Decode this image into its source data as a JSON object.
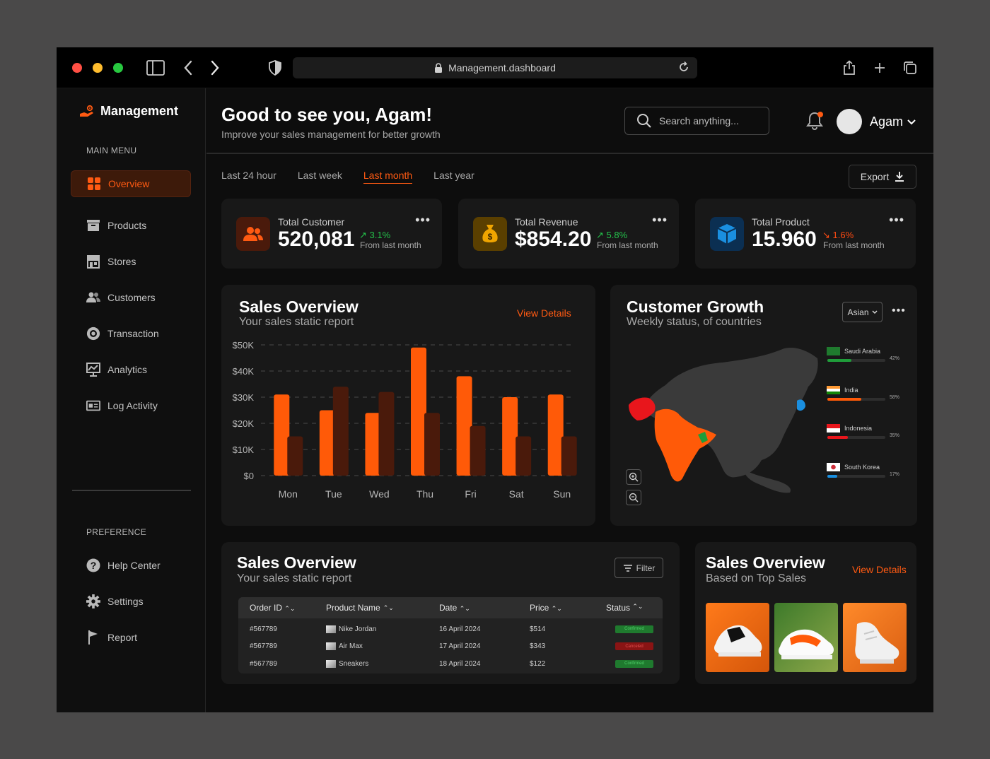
{
  "browser": {
    "url": "Management.dashboard"
  },
  "sidebar": {
    "brand": "Management",
    "main_menu_label": "MAIN MENU",
    "items": [
      {
        "label": "Overview",
        "icon": "grid-icon"
      },
      {
        "label": "Products",
        "icon": "box-icon"
      },
      {
        "label": "Stores",
        "icon": "store-icon"
      },
      {
        "label": "Customers",
        "icon": "users-icon"
      },
      {
        "label": "Transaction",
        "icon": "coin-icon"
      },
      {
        "label": "Analytics",
        "icon": "analytics-icon"
      },
      {
        "label": "Log Activity",
        "icon": "log-icon"
      }
    ],
    "preference_label": "PREFERENCE",
    "pref_items": [
      {
        "label": "Help Center",
        "icon": "help-icon"
      },
      {
        "label": "Settings",
        "icon": "gear-icon"
      },
      {
        "label": "Report",
        "icon": "flag-icon"
      }
    ]
  },
  "header": {
    "greeting": "Good to see you,  Agam!",
    "subtitle": "Improve your sales management  for better growth",
    "search_placeholder": "Search anything...",
    "user_name": "Agam"
  },
  "tabs": [
    "Last 24 hour",
    "Last week",
    "Last month",
    "Last year"
  ],
  "export_label": "Export",
  "stats": [
    {
      "label": "Total Customer",
      "value": "520,081",
      "change": "3.1%",
      "direction": "up",
      "from": "From last month"
    },
    {
      "label": "Total Revenue",
      "value": "$854.20",
      "change": "5.8%",
      "direction": "up",
      "from": "From last month"
    },
    {
      "label": "Total Product",
      "value": "15.960",
      "change": "1.6%",
      "direction": "down",
      "from": "From last month"
    }
  ],
  "sales_chart": {
    "title": "Sales Overview",
    "subtitle": "Your sales static report",
    "link": "View Details"
  },
  "chart_data": {
    "type": "bar",
    "categories": [
      "Mon",
      "Tue",
      "Wed",
      "Thu",
      "Fri",
      "Sat",
      "Sun"
    ],
    "series": [
      {
        "values": [
          31,
          25,
          24,
          49,
          38,
          30,
          31
        ],
        "color": "#ff5a08"
      },
      {
        "values": [
          15,
          34,
          32,
          24,
          19,
          15,
          15
        ],
        "color": "#4a1a0b"
      }
    ],
    "yticks": [
      "$0",
      "$10K",
      "$20K",
      "$30K",
      "$40K",
      "$50K"
    ],
    "ylim": [
      0,
      50
    ],
    "grid": true
  },
  "growth": {
    "title": "Customer Growth",
    "subtitle": "Weekly status, of countries",
    "region": "Asian",
    "countries": [
      {
        "name": "Saudi Arabia",
        "pct": "42%",
        "value": 42,
        "color": "#1f9d3a",
        "flag": "saudi-flag"
      },
      {
        "name": "India",
        "pct": "58%",
        "value": 58,
        "color": "#ff5a08",
        "flag": "india-flag"
      },
      {
        "name": "Indonesia",
        "pct": "35%",
        "value": 35,
        "color": "#e8161c",
        "flag": "indonesia-flag"
      },
      {
        "name": "South Korea",
        "pct": "17%",
        "value": 17,
        "color": "#1a8fe0",
        "flag": "korea-flag"
      }
    ]
  },
  "table_card": {
    "title": "Sales Overview",
    "subtitle": "Your sales static report",
    "filter_label": "Filter",
    "columns": [
      "Order ID",
      "Product Name",
      "Date",
      "Price",
      "Status"
    ],
    "rows": [
      {
        "id": "#567789",
        "product": "Nike Jordan",
        "date": "16 April 2024",
        "price": "$514",
        "status": "Confirmed",
        "status_color": "#1f7a2e"
      },
      {
        "id": "#567789",
        "product": "Air Max",
        "date": "17 April 2024",
        "price": "$343",
        "status": "Canceled",
        "status_color": "#8a1414"
      },
      {
        "id": "#567789",
        "product": "Sneakers",
        "date": "18 April 2024",
        "price": "$122",
        "status": "Confirmed",
        "status_color": "#1f7a2e"
      }
    ]
  },
  "top_sales": {
    "title": "Sales Overview",
    "subtitle": "Based on Top Sales",
    "link": "View Details"
  },
  "colors": {
    "accent": "#ff5a12",
    "panel": "#181818",
    "background": "#0d0d0d"
  }
}
